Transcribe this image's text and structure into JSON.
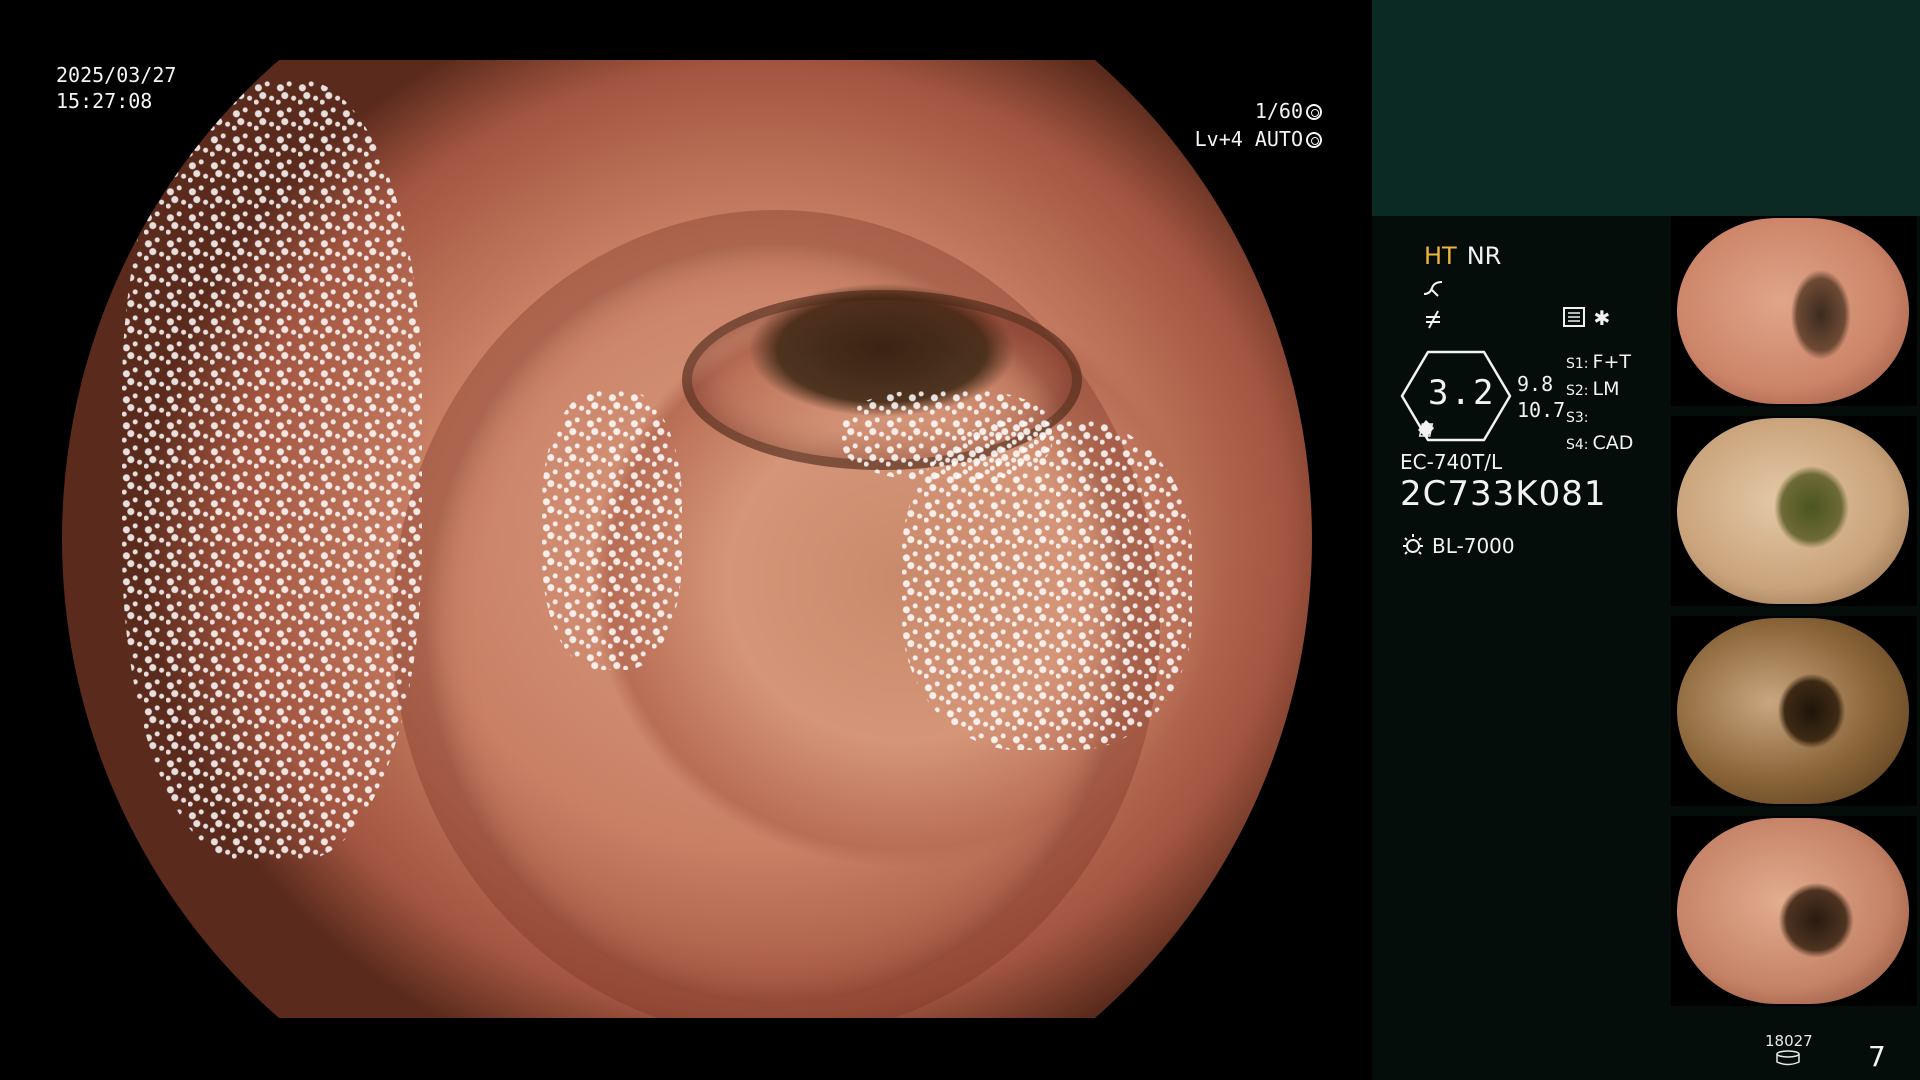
{
  "osd": {
    "date": "2025/03/27",
    "time": "15:27:08",
    "shutter": "1/60",
    "level": "Lv+4 AUTO"
  },
  "image_modes": {
    "ht": "HT",
    "nr": "NR"
  },
  "icons": {
    "curve": "contrast-curve-icon",
    "enhance": "not-equal-icon",
    "settings": "settings-list-icon",
    "star": "asterisk-icon",
    "light": "lamp-icon",
    "storage": "storage-icon"
  },
  "zoom": {
    "value": "3.2",
    "top": "9.8",
    "bottom": "10.7"
  },
  "scene_switches": [
    {
      "tag": "S1:",
      "value": "F+T"
    },
    {
      "tag": "S2:",
      "value": "LM"
    },
    {
      "tag": "S3:",
      "value": ""
    },
    {
      "tag": "S4:",
      "value": "CAD"
    }
  ],
  "scope": {
    "model": "EC-740T/L",
    "serial": "2C733K081"
  },
  "light_source": "BL-7000",
  "counter": {
    "images": "18027",
    "count": "7"
  },
  "colors": {
    "ht_accent": "#f0b441",
    "panel_band": "#0c2a24",
    "panel_bg": "#050d0b"
  }
}
